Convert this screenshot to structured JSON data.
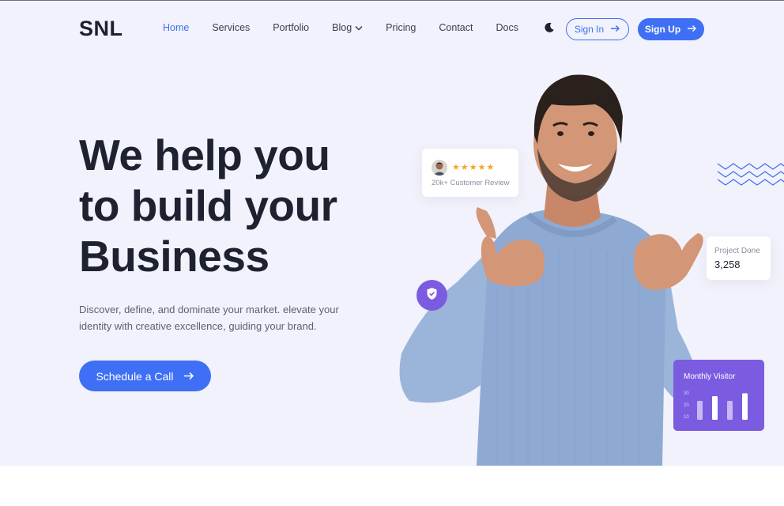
{
  "brand": {
    "logo": "SNL"
  },
  "nav": {
    "items": [
      {
        "label": "Home",
        "active": true
      },
      {
        "label": "Services",
        "active": false
      },
      {
        "label": "Portfolio",
        "active": false
      },
      {
        "label": "Blog",
        "active": false,
        "dropdown": true
      },
      {
        "label": "Pricing",
        "active": false
      },
      {
        "label": "Contact",
        "active": false
      },
      {
        "label": "Docs",
        "active": false
      }
    ],
    "theme_toggle_icon": "moon-icon",
    "signin_label": "Sign In",
    "signup_label": "Sign Up"
  },
  "hero": {
    "headline_lines": [
      "We help you",
      "to build your",
      "Business"
    ],
    "subtext": "Discover, define, and dominate your market. elevate your identity with creative excellence, guiding your brand.",
    "cta_label": "Schedule a Call"
  },
  "review_card": {
    "rating": 5,
    "stars": "★★★★★",
    "text": "20k+ Customer Review"
  },
  "project_card": {
    "label": "Project Done",
    "value": "3,258"
  },
  "visitor_card": {
    "title": "Monthly Visitor",
    "y_ticks": [
      "30",
      "20",
      "10"
    ],
    "bars": [
      20,
      25,
      20,
      28
    ],
    "bar_colors": [
      "#c8b9f6",
      "#ffffff",
      "#c8b9f6",
      "#ffffff"
    ]
  },
  "colors": {
    "accent": "#3f6ff5",
    "purple": "#7b5ce0",
    "hero_bg": "#f1f2fb",
    "heading": "#1d2130",
    "star": "#f5a623"
  }
}
